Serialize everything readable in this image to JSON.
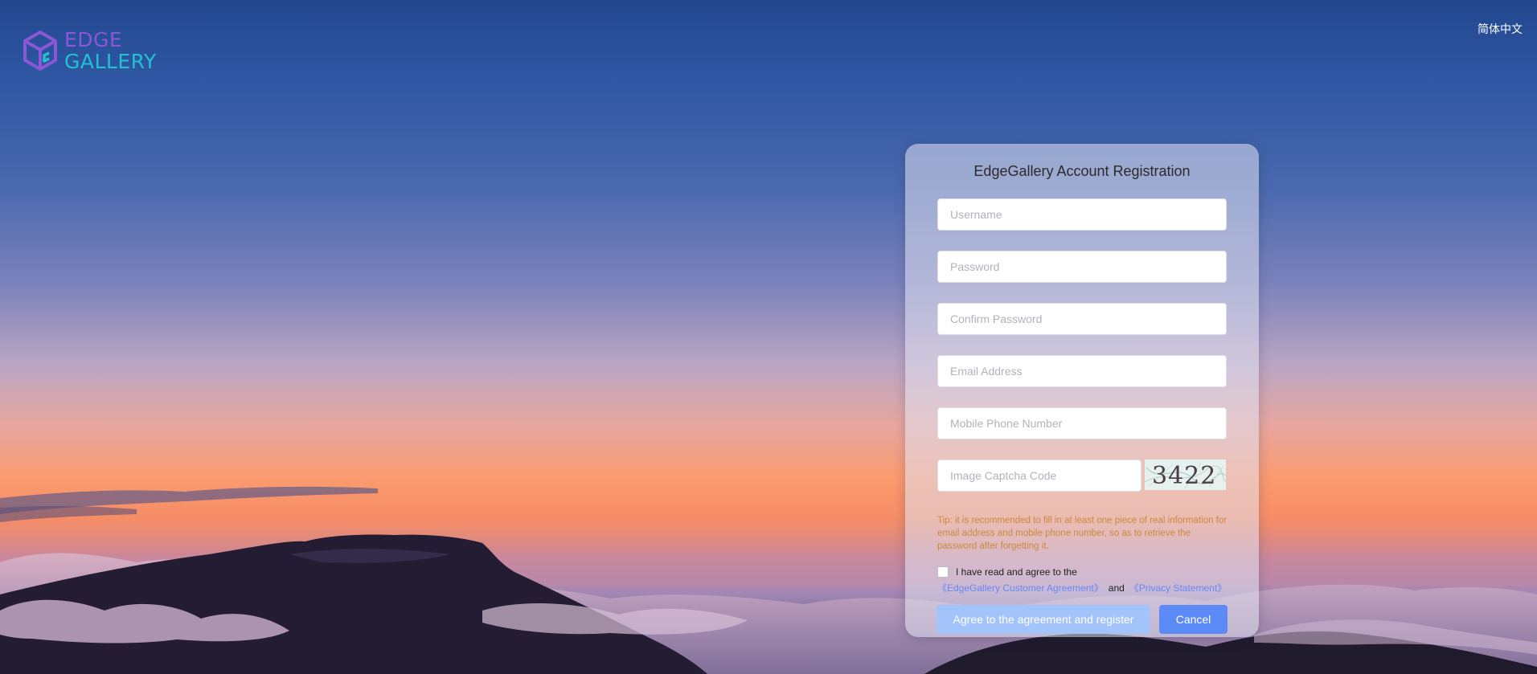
{
  "logo": {
    "line1": "EDGE",
    "line2": "GALLERY",
    "icon": "cube-g-logo-icon",
    "colors": {
      "primary": "#8a57d6",
      "secondary": "#23c0d2"
    }
  },
  "header": {
    "language_switch": "简体中文"
  },
  "form": {
    "title": "EdgeGallery Account Registration",
    "username_placeholder": "Username",
    "password_placeholder": "Password",
    "confirm_password_placeholder": "Confirm Password",
    "email_placeholder": "Email Address",
    "phone_placeholder": "Mobile Phone Number",
    "captcha_placeholder": "Image Captcha Code",
    "captcha_text": "3422",
    "tip": "Tip: it is recommended to fill in at least one piece of real information for email address and mobile phone number, so as to retrieve the password after forgetting it.",
    "agree_text": "I have read and agree to the",
    "customer_agreement_link": "《EdgeGallery Customer Agreement》",
    "and_text": "and",
    "privacy_link": "《Privacy Statement》",
    "agreement_checked": false,
    "register_button": "Agree to the agreement and register",
    "cancel_button": "Cancel"
  },
  "colors": {
    "tip": "#c98a3c",
    "link": "#6c86f2",
    "register_button": "#a3c3fb",
    "cancel_button": "#5c8af6"
  }
}
